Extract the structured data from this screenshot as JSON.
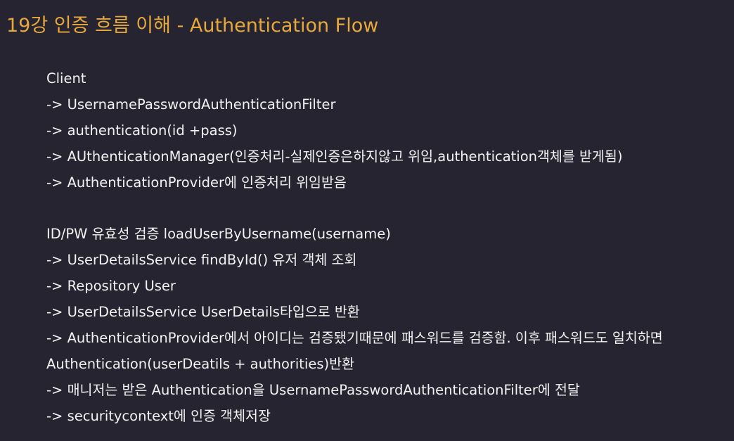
{
  "title": "19강 인증 흐름 이해 - Authentication Flow",
  "section1": [
    "Client",
    "-> UsernamePasswordAuthenticationFilter",
    "-> authentication(id +pass)",
    "-> AUthenticationManager(인증처리-실제인증은하지않고 위임,authentication객체를 받게됨)",
    "-> AuthenticationProvider에 인증처리 위임받음"
  ],
  "section2": [
    "ID/PW 유효성 검증 loadUserByUsername(username)",
    "-> UserDetailsService findById() 유저 객체 조회",
    "-> Repository User",
    "-> UserDetailsService UserDetails타입으로 반환",
    "-> AuthenticationProvider에서 아이디는 검증됐기때문에 패스워드를 검증함. 이후 패스워드도 일치하면",
    "Authentication(userDeatils + authorities)반환",
    "-> 매니저는 받은 Authentication을 UsernamePasswordAuthenticationFilter에 전달",
    "-> securitycontext에 인증 객체저장"
  ]
}
